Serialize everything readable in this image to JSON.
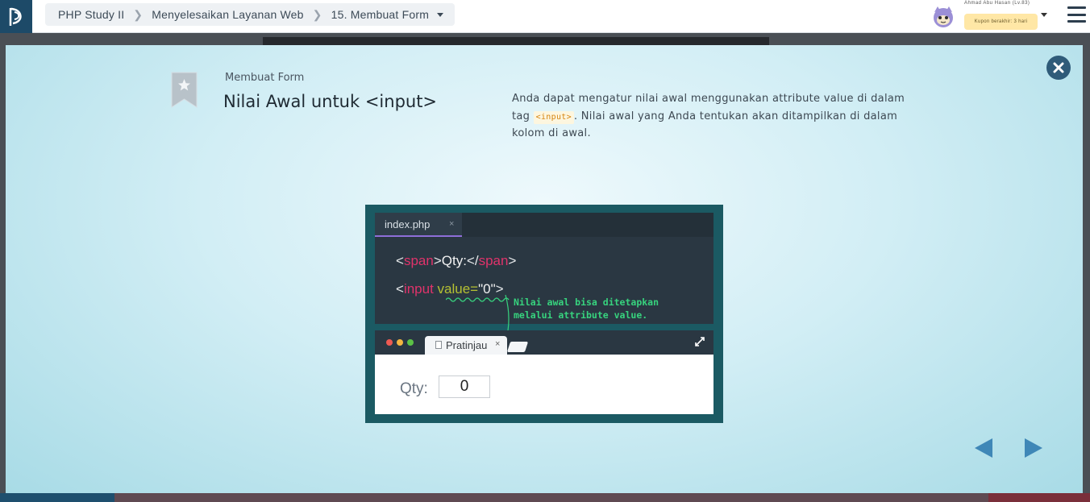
{
  "header": {
    "logo_icon": "progate-logo-icon",
    "breadcrumb": {
      "course": "PHP Study II",
      "section": "Menyelesaikan Layanan Web",
      "lesson": "15. Membuat Form"
    },
    "user": {
      "name": "Ahmad Abu Hasan (Lv.83)",
      "coupon": "Kupon berakhir: 3 hari"
    }
  },
  "slide": {
    "kicker": "Membuat Form",
    "title": "Nilai Awal untuk <input>",
    "text_before": "Anda dapat mengatur nilai awal menggunakan attribute value di dalam tag ",
    "text_code": "<input>",
    "text_after": ". Nilai awal yang Anda tentukan akan ditampilkan di dalam kolom di awal."
  },
  "illustration": {
    "file_tab": "index.php",
    "file_tab_close": "×",
    "code": {
      "line1": {
        "open_lt": "<",
        "tag": "span",
        "open_gt": ">",
        "text": "Qty:",
        "close_lt": "</",
        "close_tag": "span",
        "close_gt": ">"
      },
      "line2": {
        "lt": "<",
        "tag": "input",
        "attr": " value=",
        "value": "\"0\"",
        "gt": ">"
      }
    },
    "annotation_line1": "Nilai awal bisa ditetapkan",
    "annotation_line2": "melalui attribute value.",
    "preview_tab": "Pratinjau",
    "preview_tab_close": "×",
    "qty_label": "Qty:",
    "qty_value": "0"
  },
  "colors": {
    "accent_tag": "#e0336b",
    "accent_attr": "#b5c032",
    "annotation": "#37d37e",
    "nav_arrow": "#3f87b7"
  }
}
